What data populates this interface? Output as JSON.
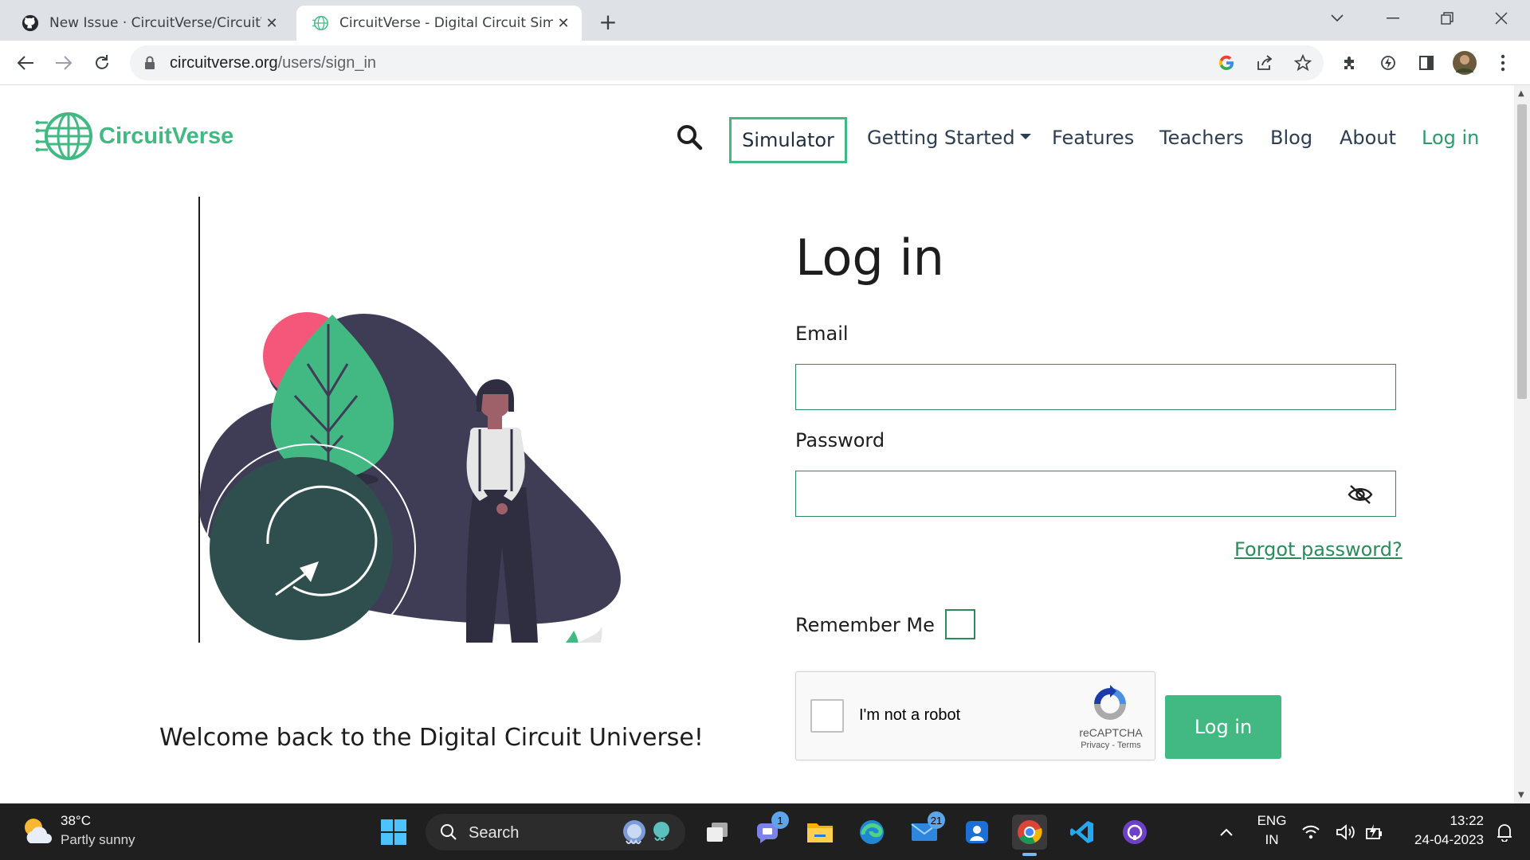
{
  "browser": {
    "tabs": [
      {
        "title": "New Issue · CircuitVerse/CircuitVe",
        "active": false,
        "icon": "github-icon"
      },
      {
        "title": "CircuitVerse - Digital Circuit Simu",
        "active": true,
        "icon": "circuitverse-globe-icon"
      }
    ],
    "new_tab_label": "+",
    "address_bar": {
      "host": "circuitverse.org",
      "path": "/users/sign_in"
    }
  },
  "site": {
    "brand": "CircuitVerse",
    "nav": {
      "simulator": "Simulator",
      "getting_started": "Getting Started",
      "features": "Features",
      "teachers": "Teachers",
      "blog": "Blog",
      "about": "About",
      "login": "Log in"
    },
    "welcome": "Welcome back to the Digital Circuit Universe!",
    "form": {
      "title": "Log in",
      "email_label": "Email",
      "email_value": "",
      "password_label": "Password",
      "password_value": "",
      "forgot": "Forgot password?",
      "remember": "Remember Me",
      "submit": "Log in"
    },
    "captcha": {
      "label": "I'm not a robot",
      "brand": "reCAPTCHA",
      "terms": "Privacy - Terms"
    }
  },
  "taskbar": {
    "weather": {
      "temp": "38°C",
      "desc": "Partly sunny"
    },
    "search_label": "Search",
    "badges": {
      "teams": "1",
      "mail": "21"
    },
    "lang": {
      "line1": "ENG",
      "line2": "IN"
    },
    "clock": {
      "time": "13:22",
      "date": "24-04-2023"
    }
  },
  "colors": {
    "brand": "#42b983",
    "input_border": "#2d8a5b",
    "blob": "#3f3d56",
    "leaf": "#42b983",
    "sun": "#f5577a"
  }
}
